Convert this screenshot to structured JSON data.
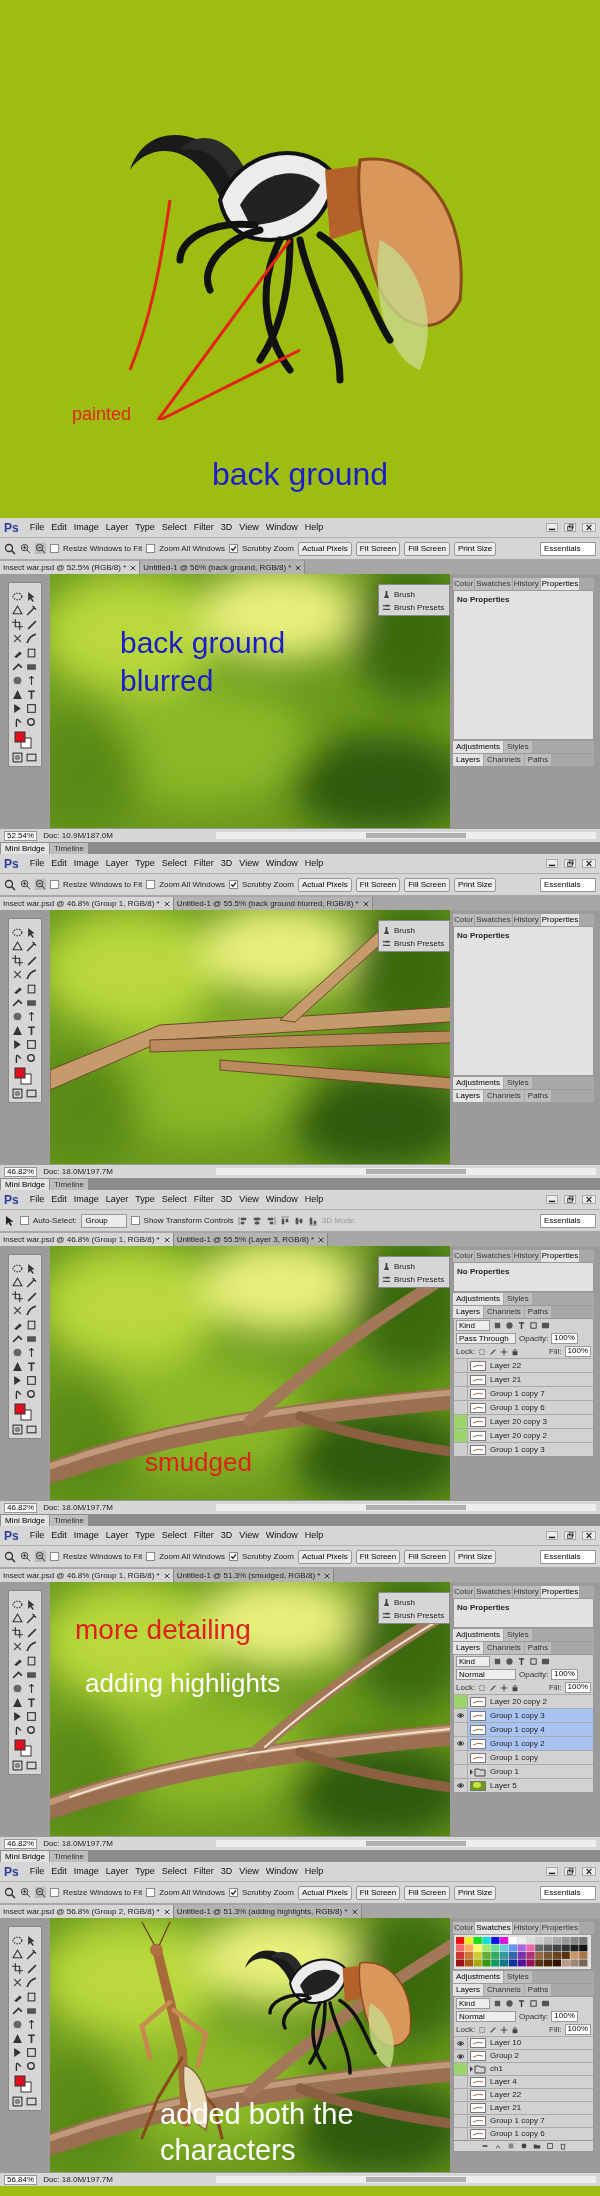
{
  "illustration": {
    "annotations": [
      {
        "kind": "label",
        "text": "painted"
      },
      {
        "kind": "caption",
        "text": "back ground"
      }
    ]
  },
  "screens": [
    {
      "logo": "Ps",
      "menu": [
        "File",
        "Edit",
        "Image",
        "Layer",
        "Type",
        "Select",
        "Filter",
        "3D",
        "View",
        "Window",
        "Help"
      ],
      "options": {
        "kind": "zoom",
        "items": [
          {
            "kind": "checkbox",
            "label": "Resize Windows to Fit",
            "checked": false
          },
          {
            "kind": "checkbox",
            "label": "Zoom All Windows",
            "checked": false
          },
          {
            "kind": "checkbox",
            "label": "Scrubby Zoom",
            "checked": true
          },
          {
            "kind": "button",
            "label": "Actual Pixels"
          },
          {
            "kind": "button",
            "label": "Fit Screen"
          },
          {
            "kind": "button",
            "label": "Fill Screen"
          },
          {
            "kind": "button",
            "label": "Print Size"
          }
        ]
      },
      "workspace": "Essentials",
      "documents": [
        {
          "title": "Insect war.psd @ 52.5% (RGB/8) *",
          "selected": true
        },
        {
          "title": "Untitled-1 @ 56% (back ground, RGB/8) *",
          "selected": false
        }
      ],
      "canvas": {
        "kind": "blurred-background",
        "captions": [
          {
            "text": "back ground blurred",
            "color": "#1c1cc8"
          }
        ]
      },
      "brush_panel": [
        "Brush",
        "Brush Presets"
      ],
      "panel_tabs": [
        {
          "label": "Color",
          "selected": false
        },
        {
          "label": "Swatches",
          "selected": false
        },
        {
          "label": "History",
          "selected": false
        },
        {
          "label": "Properties",
          "selected": true
        }
      ],
      "panel_content": {
        "kind": "properties",
        "text": "No Properties"
      },
      "group_tabs": [
        [
          {
            "label": "Adjustments",
            "selected": true
          },
          {
            "label": "Styles",
            "selected": false
          }
        ],
        [
          {
            "label": "Layers",
            "selected": true
          },
          {
            "label": "Channels",
            "selected": false
          },
          {
            "label": "Paths",
            "selected": false
          }
        ]
      ],
      "status": {
        "zoom": "52.54%",
        "doc": "Doc: 10.9M/187.0M"
      },
      "bottom_tabs": [
        {
          "label": "Mini Bridge",
          "selected": true
        },
        {
          "label": "Timeline",
          "selected": false
        }
      ]
    },
    {
      "logo": "Ps",
      "menu": [
        "File",
        "Edit",
        "Image",
        "Layer",
        "Type",
        "Select",
        "Filter",
        "3D",
        "View",
        "Window",
        "Help"
      ],
      "options": {
        "kind": "zoom",
        "items": [
          {
            "kind": "checkbox",
            "label": "Resize Windows to Fit",
            "checked": false
          },
          {
            "kind": "checkbox",
            "label": "Zoom All Windows",
            "checked": false
          },
          {
            "kind": "checkbox",
            "label": "Scrubby Zoom",
            "checked": true
          },
          {
            "kind": "button",
            "label": "Actual Pixels"
          },
          {
            "kind": "button",
            "label": "Fit Screen"
          },
          {
            "kind": "button",
            "label": "Fill Screen"
          },
          {
            "kind": "button",
            "label": "Print Size"
          }
        ]
      },
      "workspace": "Essentials",
      "documents": [
        {
          "title": "Insect war.psd @ 46.8% (Group 1, RGB/8) *",
          "selected": true
        },
        {
          "title": "Untitled-1 @ 55.5% (back ground blurred, RGB/8) *",
          "selected": false
        }
      ],
      "canvas": {
        "kind": "wooden-planks"
      },
      "brush_panel": [
        "Brush",
        "Brush Presets"
      ],
      "panel_tabs": [
        {
          "label": "Color",
          "selected": false
        },
        {
          "label": "Swatches",
          "selected": false
        },
        {
          "label": "History",
          "selected": false
        },
        {
          "label": "Properties",
          "selected": true
        }
      ],
      "panel_content": {
        "kind": "properties",
        "text": "No Properties"
      },
      "group_tabs": [
        [
          {
            "label": "Adjustments",
            "selected": true
          },
          {
            "label": "Styles",
            "selected": false
          }
        ],
        [
          {
            "label": "Layers",
            "selected": true
          },
          {
            "label": "Channels",
            "selected": false
          },
          {
            "label": "Paths",
            "selected": false
          }
        ]
      ],
      "status": {
        "zoom": "46.82%",
        "doc": "Doc: 18.0M/197.7M"
      },
      "bottom_tabs": [
        {
          "label": "Mini Bridge",
          "selected": true
        },
        {
          "label": "Timeline",
          "selected": false
        }
      ]
    },
    {
      "logo": "Ps",
      "menu": [
        "File",
        "Edit",
        "Image",
        "Layer",
        "Type",
        "Select",
        "Filter",
        "3D",
        "View",
        "Window",
        "Help"
      ],
      "options": {
        "kind": "move",
        "items": [
          {
            "kind": "checkbox",
            "label": "Auto-Select:",
            "checked": false
          },
          {
            "kind": "dropdown",
            "label": "Group"
          },
          {
            "kind": "checkbox",
            "label": "Show Transform Controls",
            "checked": false
          },
          {
            "kind": "align-icons"
          },
          {
            "kind": "label",
            "label": "3D Mode:"
          }
        ]
      },
      "workspace": "Essentials",
      "documents": [
        {
          "title": "Insect war.psd @ 46.8% (Group 1, RGB/8) *",
          "selected": true
        },
        {
          "title": "Untitled-1 @ 55.5% (Layer 3, RGB/8) *",
          "selected": false
        }
      ],
      "canvas": {
        "kind": "branches",
        "captions": [
          {
            "text": "smudged",
            "color": "#e0201c"
          }
        ]
      },
      "brush_panel": [
        "Brush",
        "Brush Presets"
      ],
      "panel_tabs": [
        {
          "label": "Color",
          "selected": false
        },
        {
          "label": "Swatches",
          "selected": false
        },
        {
          "label": "History",
          "selected": false
        },
        {
          "label": "Properties",
          "selected": true
        }
      ],
      "panel_content": {
        "kind": "properties",
        "text": "No Properties"
      },
      "group_tabs": [
        [
          {
            "label": "Adjustments",
            "selected": true
          },
          {
            "label": "Styles",
            "selected": false
          }
        ],
        [
          {
            "label": "Layers",
            "selected": true
          },
          {
            "label": "Channels",
            "selected": false
          },
          {
            "label": "Paths",
            "selected": false
          }
        ]
      ],
      "layers_panel": {
        "kind_filter": "Kind",
        "blend": "Pass Through",
        "opacity_label": "Opacity:",
        "opacity": "100%",
        "lock_label": "Lock:",
        "fill_label": "Fill:",
        "fill": "100%",
        "footer": false,
        "layers": [
          {
            "kind": "layer",
            "name": "Layer 22",
            "visible": false,
            "tagged": false,
            "selected": false
          },
          {
            "kind": "layer",
            "name": "Layer 21",
            "visible": false,
            "tagged": false,
            "selected": false
          },
          {
            "kind": "layer",
            "name": "Group 1 copy 7",
            "visible": false,
            "tagged": false,
            "selected": false
          },
          {
            "kind": "layer",
            "name": "Group 1 copy 6",
            "visible": false,
            "tagged": false,
            "selected": false
          },
          {
            "kind": "layer",
            "name": "Layer 20 copy 3",
            "visible": false,
            "tagged": true,
            "selected": false
          },
          {
            "kind": "layer",
            "name": "Layer 20 copy 2",
            "visible": false,
            "tagged": true,
            "selected": false
          },
          {
            "kind": "layer",
            "name": "Group 1 copy 3",
            "visible": false,
            "tagged": false,
            "selected": false
          }
        ]
      },
      "status": {
        "zoom": "46.82%",
        "doc": "Doc: 18.0M/197.7M"
      },
      "bottom_tabs": [
        {
          "label": "Mini Bridge",
          "selected": true
        },
        {
          "label": "Timeline",
          "selected": false
        }
      ]
    },
    {
      "logo": "Ps",
      "menu": [
        "File",
        "Edit",
        "Image",
        "Layer",
        "Type",
        "Select",
        "Filter",
        "3D",
        "View",
        "Window",
        "Help"
      ],
      "options": {
        "kind": "zoom",
        "items": [
          {
            "kind": "checkbox",
            "label": "Resize Windows to Fit",
            "checked": false
          },
          {
            "kind": "checkbox",
            "label": "Zoom All Windows",
            "checked": false
          },
          {
            "kind": "checkbox",
            "label": "Scrubby Zoom",
            "checked": true
          },
          {
            "kind": "button",
            "label": "Actual Pixels"
          },
          {
            "kind": "button",
            "label": "Fit Screen"
          },
          {
            "kind": "button",
            "label": "Fill Screen"
          },
          {
            "kind": "button",
            "label": "Print Size"
          }
        ]
      },
      "workspace": "Essentials",
      "documents": [
        {
          "title": "Insect war.psd @ 46.8% (Group 1, RGB/8) *",
          "selected": true
        },
        {
          "title": "Untitled-1 @ 51.3% (smudged, RGB/8) *",
          "selected": false
        }
      ],
      "canvas": {
        "kind": "highlighted-branches",
        "captions": [
          {
            "text": "more detailing",
            "color": "#e0201c"
          },
          {
            "text": "adding highlights",
            "color": "#ffffff"
          }
        ]
      },
      "brush_panel": [
        "Brush",
        "Brush Presets"
      ],
      "panel_tabs": [
        {
          "label": "Color",
          "selected": false
        },
        {
          "label": "Swatches",
          "selected": false
        },
        {
          "label": "History",
          "selected": false
        },
        {
          "label": "Properties",
          "selected": true
        }
      ],
      "panel_content": {
        "kind": "properties",
        "text": "No Properties"
      },
      "group_tabs": [
        [
          {
            "label": "Adjustments",
            "selected": true
          },
          {
            "label": "Styles",
            "selected": false
          }
        ],
        [
          {
            "label": "Layers",
            "selected": true
          },
          {
            "label": "Channels",
            "selected": false
          },
          {
            "label": "Paths",
            "selected": false
          }
        ]
      ],
      "layers_panel": {
        "kind_filter": "Kind",
        "blend": "Normal",
        "opacity_label": "Opacity:",
        "opacity": "100%",
        "lock_label": "Lock:",
        "fill_label": "Fill:",
        "fill": "100%",
        "footer": false,
        "layers": [
          {
            "kind": "layer",
            "name": "Layer 20 copy 2",
            "visible": false,
            "tagged": true,
            "selected": false
          },
          {
            "kind": "layer",
            "name": "Group 1 copy 3",
            "visible": true,
            "tagged": false,
            "selected": true
          },
          {
            "kind": "layer",
            "name": "Group 1 copy 4",
            "visible": false,
            "tagged": false,
            "selected": true
          },
          {
            "kind": "layer",
            "name": "Group 1 copy 2",
            "visible": true,
            "tagged": false,
            "selected": true
          },
          {
            "kind": "layer",
            "name": "Group 1 copy",
            "visible": false,
            "tagged": false,
            "selected": false
          },
          {
            "kind": "group",
            "name": "Group 1",
            "visible": false,
            "tagged": false,
            "selected": false
          },
          {
            "kind": "image",
            "name": "Layer 5",
            "visible": true,
            "tagged": false,
            "selected": false
          }
        ]
      },
      "status": {
        "zoom": "46.82%",
        "doc": "Doc: 18.0M/197.7M"
      },
      "bottom_tabs": [
        {
          "label": "Mini Bridge",
          "selected": true
        },
        {
          "label": "Timeline",
          "selected": false
        }
      ]
    },
    {
      "logo": "Ps",
      "menu": [
        "File",
        "Edit",
        "Image",
        "Layer",
        "Type",
        "Select",
        "Filter",
        "3D",
        "View",
        "Window",
        "Help"
      ],
      "options": {
        "kind": "zoom",
        "items": [
          {
            "kind": "checkbox",
            "label": "Resize Windows to Fit",
            "checked": false
          },
          {
            "kind": "checkbox",
            "label": "Zoom All Windows",
            "checked": false
          },
          {
            "kind": "checkbox",
            "label": "Scrubby Zoom",
            "checked": true
          },
          {
            "kind": "button",
            "label": "Actual Pixels"
          },
          {
            "kind": "button",
            "label": "Fit Screen"
          },
          {
            "kind": "button",
            "label": "Fill Screen"
          },
          {
            "kind": "button",
            "label": "Print Size"
          }
        ]
      },
      "workspace": "Essentials",
      "documents": [
        {
          "title": "Insect war.psd @ 56.8% (Group 2, RGB/8) *",
          "selected": true
        },
        {
          "title": "Untitled-1 @ 51.3% (adding highlights, RGB/8) *",
          "selected": false
        }
      ],
      "canvas": {
        "kind": "insects-on-branches",
        "captions": [
          {
            "text": "added both the characters",
            "color": "#ffffff"
          }
        ]
      },
      "panel_tabs": [
        {
          "label": "Color",
          "selected": false
        },
        {
          "label": "Swatches",
          "selected": true
        },
        {
          "label": "History",
          "selected": false
        },
        {
          "label": "Properties",
          "selected": false
        }
      ],
      "panel_content": {
        "kind": "swatches"
      },
      "group_tabs": [
        [
          {
            "label": "Adjustments",
            "selected": true
          },
          {
            "label": "Styles",
            "selected": false
          }
        ],
        [
          {
            "label": "Layers",
            "selected": true
          },
          {
            "label": "Channels",
            "selected": false
          },
          {
            "label": "Paths",
            "selected": false
          }
        ]
      ],
      "layers_panel": {
        "kind_filter": "Kind",
        "blend": "Normal",
        "opacity_label": "Opacity:",
        "opacity": "100%",
        "lock_label": "Lock:",
        "fill_label": "Fill:",
        "fill": "100%",
        "footer": true,
        "layers": [
          {
            "kind": "layer",
            "name": "Layer 10",
            "visible": true,
            "tagged": false,
            "selected": false
          },
          {
            "kind": "layer",
            "name": "Group 2",
            "visible": true,
            "tagged": false,
            "selected": false
          },
          {
            "kind": "group",
            "name": "ch1",
            "visible": false,
            "tagged": true,
            "selected": false
          },
          {
            "kind": "layer",
            "name": "Layer 4",
            "visible": false,
            "tagged": false,
            "selected": false
          },
          {
            "kind": "layer",
            "name": "Layer 22",
            "visible": false,
            "tagged": false,
            "selected": false
          },
          {
            "kind": "layer",
            "name": "Layer 21",
            "visible": false,
            "tagged": false,
            "selected": false
          },
          {
            "kind": "layer",
            "name": "Group 1 copy 7",
            "visible": false,
            "tagged": false,
            "selected": false
          },
          {
            "kind": "layer",
            "name": "Group 1 copy 6",
            "visible": false,
            "tagged": false,
            "selected": false
          }
        ]
      },
      "status": {
        "zoom": "56.84%",
        "doc": "Doc: 18.0M/197.7M"
      }
    }
  ]
}
